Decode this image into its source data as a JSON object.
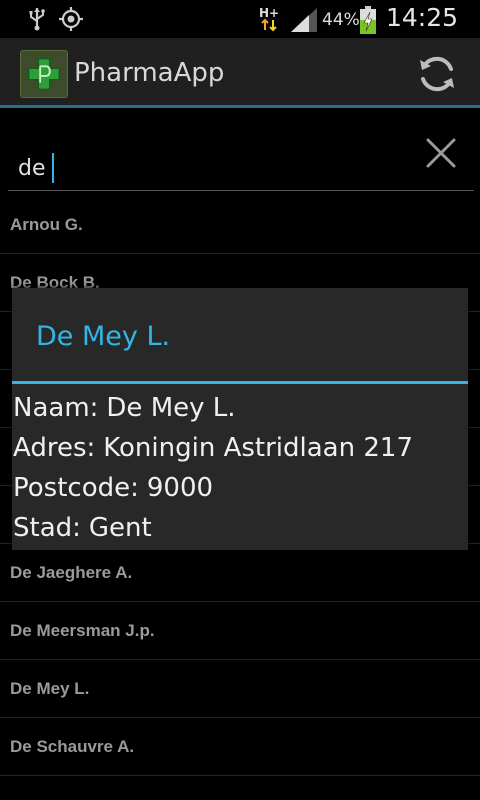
{
  "status_bar": {
    "network_type": "H+",
    "battery_percent": "44%",
    "time": "14:25",
    "icons": [
      "usb-icon",
      "gps-icon",
      "network-arrows-icon",
      "signal-icon",
      "battery-charging-icon"
    ]
  },
  "action_bar": {
    "title": "PharmaApp",
    "icons": [
      "app-logo-icon",
      "refresh-icon"
    ]
  },
  "search": {
    "value": "de",
    "icons": [
      "clear-icon"
    ]
  },
  "results": [
    "Arnou G.",
    "De Bock B.",
    "De Jaeghere A.",
    "De Meersman J.p.",
    "De Mey L.",
    "De Schauvre A."
  ],
  "dialog": {
    "title": "De Mey L.",
    "fields": [
      {
        "label": "Naam:",
        "value": "De Mey L."
      },
      {
        "label": "Adres:",
        "value": "Koningin Astridlaan 217"
      },
      {
        "label": "Postcode:",
        "value": "9000"
      },
      {
        "label": "Stad:",
        "value": "Gent"
      }
    ]
  },
  "colors": {
    "accent": "#33b5e5",
    "action_bar": "#202020",
    "dialog_bg": "#282828",
    "list_text": "#9a9a9a",
    "battery_charge": "#7dc31e"
  }
}
